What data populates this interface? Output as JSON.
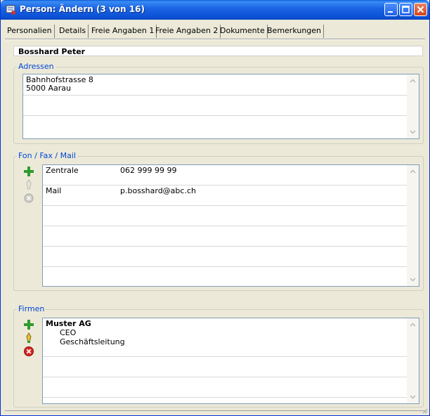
{
  "window": {
    "title": "Person: Ändern (3 von 16)",
    "controls": [
      "minimize-icon",
      "maximize-icon",
      "close-icon"
    ]
  },
  "tabs": [
    {
      "label": "Personalien"
    },
    {
      "label": "Details"
    },
    {
      "label": "Freie Angaben 1"
    },
    {
      "label": "Freie Angaben 2"
    },
    {
      "label": "Dokumente"
    },
    {
      "label": "Bemerkungen"
    }
  ],
  "person": {
    "name": "Bosshard Peter"
  },
  "adressen": {
    "title": "Adressen",
    "lines": [
      "Bahnhofstrasse 8",
      "5000 Aarau"
    ]
  },
  "kontakt": {
    "title": "Fon / Fax / Mail",
    "entries": [
      {
        "type": "Zentrale",
        "value": "062 999 99 99"
      },
      {
        "type": "Mail",
        "value": "p.bosshard@abc.ch"
      }
    ]
  },
  "firmen": {
    "title": "Firmen",
    "entries": [
      {
        "name": "Muster AG",
        "role": "CEO",
        "department": "Geschäftsleitung"
      }
    ]
  },
  "colors": {
    "titlebar": "#0b51d6",
    "group_title": "#0046d5",
    "listbox_border": "#7f9db9"
  }
}
